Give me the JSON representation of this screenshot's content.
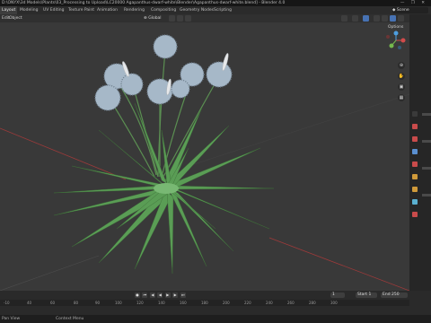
{
  "title": "D:\\ONYX\\3d Models\\Plants\\03_Processing to Upload\\LC20000 Agapanthus-dwarf-white\\Blender\\Agapanthus-dwarf-white.blend] - Blender 4.0",
  "window_controls": "— ❐ ✕",
  "menus": [
    "Layout",
    "Modeling",
    "UV Editing",
    "Texture Paint",
    "Animation",
    "Rendering",
    "Compositing",
    "Geometry Nodes",
    "Scripting"
  ],
  "active_menu": "Layout",
  "scene_label": "Scene",
  "header": {
    "mode": "Edit",
    "object": "Object",
    "transform": "Global"
  },
  "options_label": "Options",
  "timeline": {
    "current_frame": "1",
    "start_label": "Start",
    "start_value": "1",
    "end_label": "End",
    "end_value": "250",
    "ruler_ticks": [
      "-10",
      "40",
      "60",
      "80",
      "90",
      "100",
      "120",
      "140",
      "160",
      "180",
      "200",
      "220",
      "240",
      "260",
      "280",
      "300"
    ]
  },
  "status": {
    "left": "Pan View",
    "middle": "Context Menu"
  },
  "colors": {
    "viewport_bg": "#393939",
    "grass": "#5a9d55",
    "flower": "#a6b8c8",
    "x_axis": "#9e3a3a",
    "accent": "#4772b3"
  }
}
